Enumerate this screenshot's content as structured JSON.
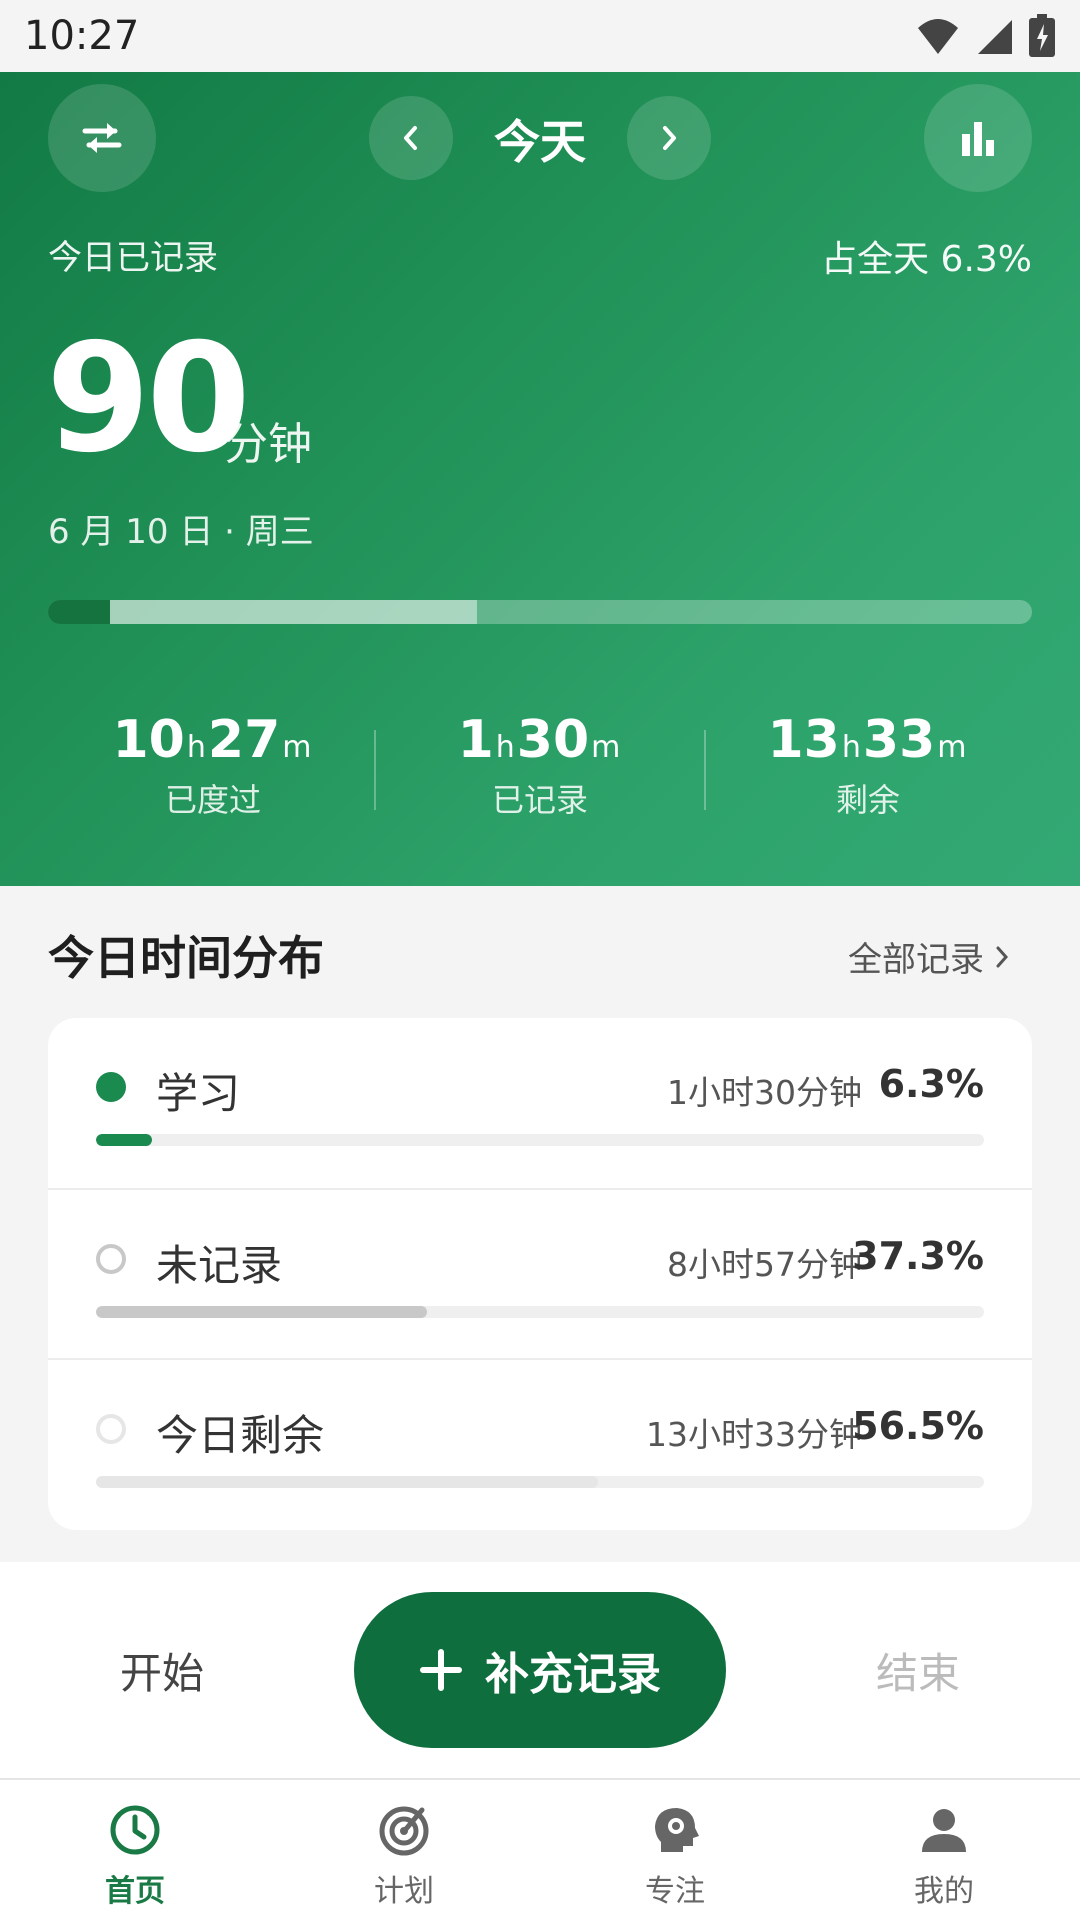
{
  "status_bar": {
    "time": "10:27"
  },
  "header": {
    "title": "今天",
    "swap_icon": "swap-icon",
    "prev_icon": "chevron-left-icon",
    "next_icon": "chevron-right-icon",
    "stats_icon": "bar-chart-icon"
  },
  "summary": {
    "label": "今日已记录",
    "share_text": "占全天 6.3%",
    "minutes": "90",
    "unit": "分钟",
    "date": "6 月 10 日 · 周三",
    "day_progress": {
      "recorded_fraction": 0.063,
      "unrecorded_fraction": 0.373,
      "remaining_fraction": 0.565
    }
  },
  "stats": [
    {
      "h": "10",
      "m": "27",
      "h_unit": "h",
      "m_unit": "m",
      "label": "已度过"
    },
    {
      "h": "1",
      "m": "30",
      "h_unit": "h",
      "m_unit": "m",
      "label": "已记录"
    },
    {
      "h": "13",
      "m": "33",
      "h_unit": "h",
      "m_unit": "m",
      "label": "剩余"
    }
  ],
  "distribution": {
    "title": "今日时间分布",
    "all_records_label": "全部记录",
    "rows": [
      {
        "label": "学习",
        "time": "1小时30分钟",
        "percent": "6.3%",
        "fraction": 0.063,
        "color": "#1a8a4f",
        "style": "filled"
      },
      {
        "label": "未记录",
        "time": "8小时57分钟",
        "percent": "37.3%",
        "fraction": 0.373,
        "color": "#c8c8c8",
        "style": "outline"
      },
      {
        "label": "今日剩余",
        "time": "13小时33分钟",
        "percent": "56.5%",
        "fraction": 0.565,
        "color": "#e6e6e6",
        "style": "outline"
      }
    ]
  },
  "actions": {
    "start_label": "开始",
    "add_label": "补充记录",
    "end_label": "结束"
  },
  "nav": [
    {
      "label": "首页",
      "icon": "clock-icon",
      "active": true
    },
    {
      "label": "计划",
      "icon": "target-icon",
      "active": false
    },
    {
      "label": "专注",
      "icon": "head-focus-icon",
      "active": false
    },
    {
      "label": "我的",
      "icon": "person-icon",
      "active": false
    }
  ],
  "colors": {
    "primary": "#0f6e3e",
    "accent": "#1a8a4f",
    "hero_start": "#127a45",
    "hero_end": "#33a874"
  }
}
